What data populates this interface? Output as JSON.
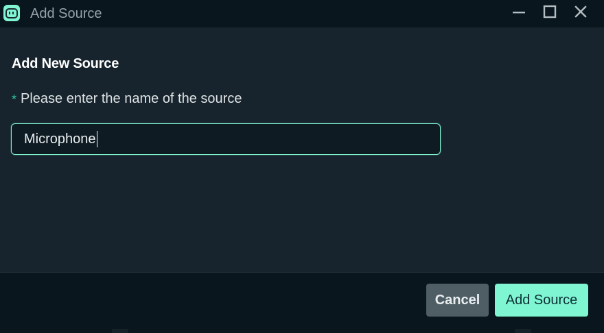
{
  "window": {
    "title": "Add Source",
    "controls": [
      "minimize-icon",
      "maximize-icon",
      "close-icon"
    ]
  },
  "form": {
    "heading": "Add New Source",
    "required_mark": "*",
    "field_label": "Please enter the name of the source",
    "input_value": "Microphone"
  },
  "buttons": {
    "cancel_label": "Cancel",
    "add_label": "Add Source"
  },
  "colors": {
    "accent": "#80f5d2",
    "required": "#30c9a6",
    "cancel_bg": "#4f5e65",
    "panel_bg": "#17242d",
    "titlebar_bg": "#09161d"
  }
}
